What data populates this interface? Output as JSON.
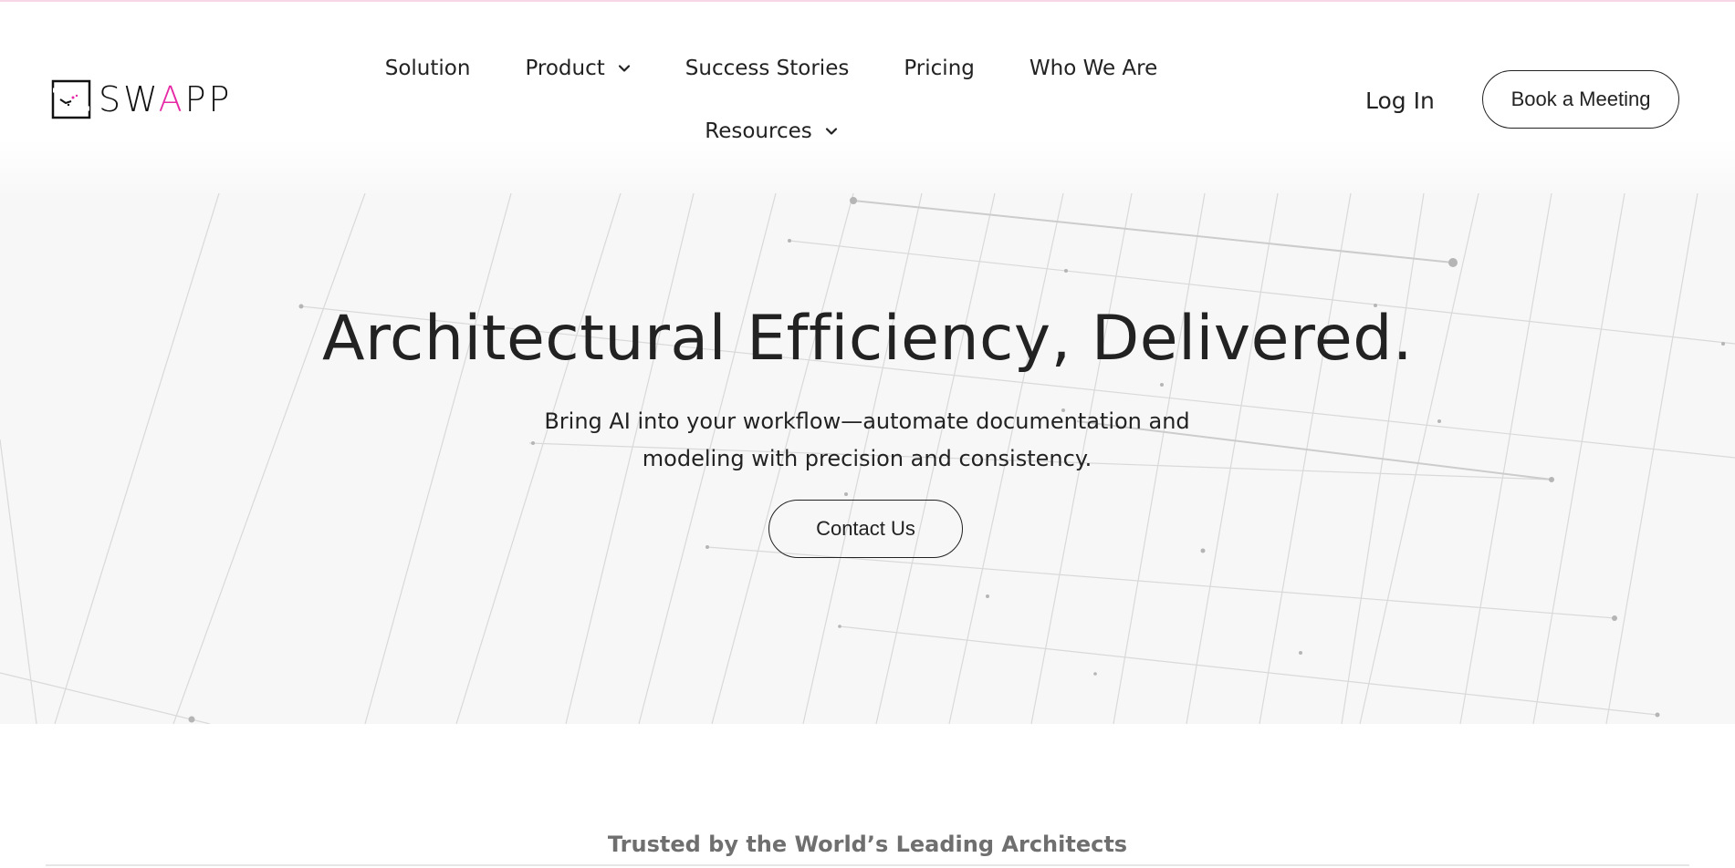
{
  "brand": {
    "name_prefix": "SW",
    "name_highlight": "A",
    "name_suffix": "PP",
    "accent_color": "#e62aa6"
  },
  "nav": {
    "row1": [
      {
        "label": "Solution",
        "has_dropdown": false
      },
      {
        "label": "Product",
        "has_dropdown": true
      },
      {
        "label": "Success Stories",
        "has_dropdown": false
      },
      {
        "label": "Pricing",
        "has_dropdown": false
      },
      {
        "label": "Who We Are",
        "has_dropdown": false
      }
    ],
    "row2": [
      {
        "label": "Resources",
        "has_dropdown": true
      }
    ]
  },
  "header": {
    "login_label": "Log In",
    "cta_label": "Book a Meeting"
  },
  "hero": {
    "title": "Architectural Efficiency, Delivered.",
    "subtitle_line1": "Bring AI into your workflow—automate documentation and",
    "subtitle_line2": "modeling with precision and consistency.",
    "cta_label": "Contact Us"
  },
  "trusted": {
    "heading": "Trusted by the World’s Leading Architects"
  },
  "icons": {
    "logo": "swapp-logo-icon",
    "dropdown": "chevron-down-icon"
  }
}
